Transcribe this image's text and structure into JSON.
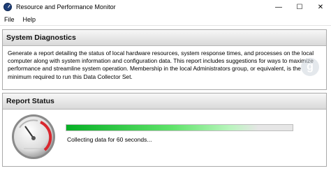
{
  "window": {
    "title": "Resource and Performance Monitor",
    "controls": {
      "minimize": "—",
      "maximize": "☐",
      "close": "✕"
    }
  },
  "menu": {
    "items": [
      "File",
      "Help"
    ]
  },
  "diagnostics": {
    "header": "System Diagnostics",
    "description": "Generate a report detailing the status of local hardware resources, system response times, and processes on the local computer along with system information and configuration data. This report includes suggestions for ways to maximize performance and streamline system operation. Membership in the local Administrators group, or equivalent, is the minimum required to run this Data Collector Set."
  },
  "report": {
    "header": "Report Status",
    "progress": 0.85,
    "status_text": "Collecting data for 60 seconds...",
    "progress_color": "#06b025"
  },
  "icons": {
    "app": "performance-monitor-icon",
    "gauge": "speedometer-gauge-icon",
    "watermark": "site-logo"
  }
}
